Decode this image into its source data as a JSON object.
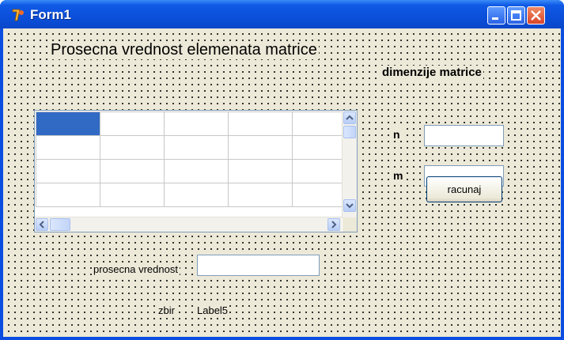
{
  "window": {
    "title": "Form1"
  },
  "form": {
    "heading": "Prosecna vrednost elemenata matrice",
    "dimensions_label": "dimenzije matrice",
    "n_label": "n",
    "n_value": "",
    "m_label": "m",
    "m_value": "",
    "compute_button": "racunaj",
    "average_label": "prosecna vrednost",
    "average_value": "",
    "sum_label": "zbir",
    "sum_value": "Label5"
  },
  "grid": {
    "rows": [
      [
        "",
        "",
        "",
        "",
        ""
      ],
      [
        "",
        "",
        "",
        "",
        ""
      ],
      [
        "",
        "",
        "",
        "",
        ""
      ],
      [
        "",
        "",
        "",
        "",
        ""
      ]
    ],
    "selected_cell": "row 1, column 1",
    "selection_color": "#316ac5"
  },
  "colors": {
    "title_bar": "#0b4fd9",
    "form_background": "#ece9d8",
    "close_button": "#d9462a"
  },
  "icons": {
    "app": "delphi-app-icon",
    "minimize": "minimize-icon",
    "maximize": "maximize-icon",
    "close": "close-icon"
  }
}
